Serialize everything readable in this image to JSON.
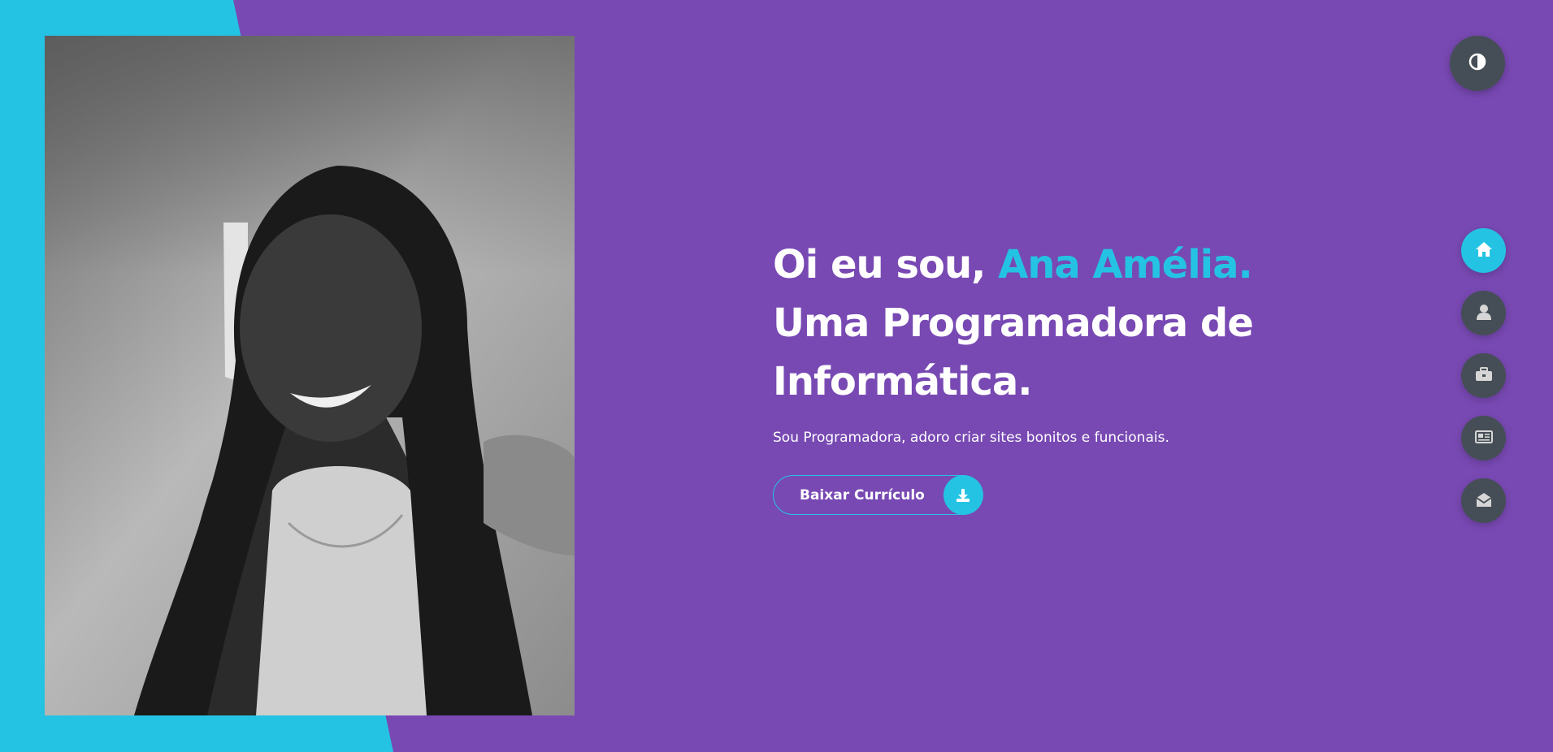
{
  "hero": {
    "greeting": "Oi eu sou, ",
    "name": "Ana Amélia.",
    "line2": "Uma Programadora de",
    "line3": "Informática.",
    "description": "Sou Programadora, adoro criar sites bonitos e funcionais.",
    "cv_button_label": "Baixar Currículo"
  },
  "theme_toggle": {
    "icon": "contrast-icon"
  },
  "nav": {
    "items": [
      {
        "icon": "home-icon",
        "active": true
      },
      {
        "icon": "user-icon",
        "active": false
      },
      {
        "icon": "briefcase-icon",
        "active": false
      },
      {
        "icon": "newspaper-icon",
        "active": false
      },
      {
        "icon": "envelope-open-icon",
        "active": false
      }
    ]
  },
  "colors": {
    "background": "#7849b3",
    "accent": "#25c3e3",
    "button_dark": "#454e56",
    "text": "#ffffff"
  }
}
